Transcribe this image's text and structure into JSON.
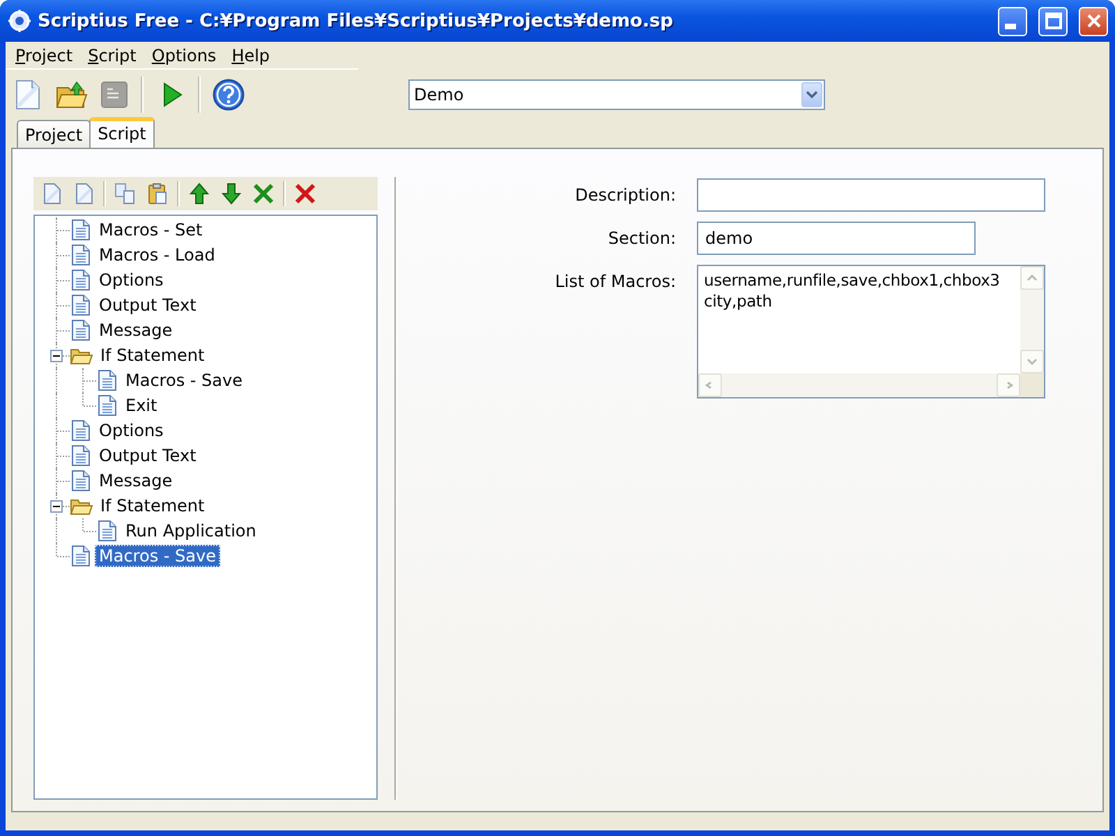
{
  "window": {
    "title": "Scriptius Free - C:¥Program Files¥Scriptius¥Projects¥demo.sp"
  },
  "menu": [
    {
      "label": "Project"
    },
    {
      "label": "Script"
    },
    {
      "label": "Options"
    },
    {
      "label": "Help"
    }
  ],
  "toolbar": [
    {
      "kind": "new",
      "disabled": false
    },
    {
      "kind": "open",
      "disabled": false
    },
    {
      "kind": "properties",
      "disabled": true
    },
    {
      "kind": "separator"
    },
    {
      "kind": "run",
      "disabled": false
    },
    {
      "kind": "separator"
    },
    {
      "kind": "help",
      "disabled": false
    }
  ],
  "script_select": {
    "value": "Demo"
  },
  "tabs": [
    {
      "label": "Project",
      "selected": false
    },
    {
      "label": "Script",
      "selected": true
    }
  ],
  "tree_toolbar": [
    {
      "kind": "new"
    },
    {
      "kind": "new"
    },
    {
      "kind": "separator"
    },
    {
      "kind": "copy"
    },
    {
      "kind": "paste"
    },
    {
      "kind": "separator"
    },
    {
      "kind": "up"
    },
    {
      "kind": "down"
    },
    {
      "kind": "remove"
    },
    {
      "kind": "separator"
    },
    {
      "kind": "delete"
    }
  ],
  "tree": {
    "items": [
      {
        "kind": "item",
        "label": "Macros - Set",
        "selected": false
      },
      {
        "kind": "item",
        "label": "Macros - Load",
        "selected": false
      },
      {
        "kind": "item",
        "label": "Options",
        "selected": false
      },
      {
        "kind": "item",
        "label": "Output Text",
        "selected": false
      },
      {
        "kind": "item",
        "label": "Message",
        "selected": false
      },
      {
        "kind": "folder",
        "label": "If Statement",
        "selected": false,
        "expanded": true,
        "children": [
          {
            "kind": "item",
            "label": "Macros - Save",
            "selected": false
          },
          {
            "kind": "item",
            "label": "Exit",
            "selected": false
          }
        ]
      },
      {
        "kind": "item",
        "label": "Options",
        "selected": false
      },
      {
        "kind": "item",
        "label": "Output Text",
        "selected": false
      },
      {
        "kind": "item",
        "label": "Message",
        "selected": false
      },
      {
        "kind": "folder",
        "label": "If Statement",
        "selected": false,
        "expanded": true,
        "children": [
          {
            "kind": "item",
            "label": "Run Application",
            "selected": false
          }
        ]
      },
      {
        "kind": "item",
        "label": "Macros - Save",
        "selected": true
      }
    ]
  },
  "form": {
    "fields": [
      {
        "kind": "text",
        "label": "Description:"
      },
      {
        "kind": "short_text",
        "label": "Section:",
        "value": "demo"
      },
      {
        "kind": "textarea",
        "label": "List of Macros:",
        "value": "username,runfile,save,chbox1,chbox3\ncity,path"
      }
    ]
  }
}
